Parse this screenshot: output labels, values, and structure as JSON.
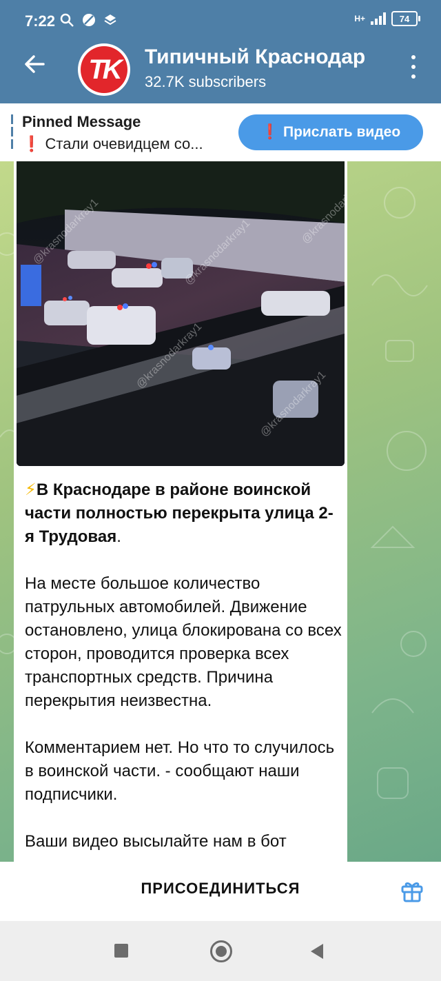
{
  "status_bar": {
    "time": "7:22",
    "network": "H+",
    "battery": "74"
  },
  "app_bar": {
    "channel_name": "Типичный Краснодар",
    "avatar_text": "TK",
    "subscribers": "32.7K subscribers"
  },
  "pinned": {
    "label": "Pinned Message",
    "preview_mark": "❗",
    "preview": "Стали очевидцем со...",
    "button_mark": "❗",
    "button_label": "Прислать видео"
  },
  "message": {
    "video_watermark": "@krasnodarkray1",
    "bolt": "⚡",
    "headline": "В Краснодаре в районе воинской части полностью перекрыта улица 2-я Трудовая",
    "headline_end": ".",
    "paragraph_2": "На месте  большое количество патрульных автомобилей. Движение остановлено, улица блокирована со всех сторон, проводится проверка всех транспортных средств. Причина перекрытия неизвестна.",
    "paragraph_3": "Комментарием нет. Но что то случилось в воинской части. - сообщают наши подписчики.",
    "paragraph_4": "Ваши видео высылайте нам в бот"
  },
  "join_bar": {
    "join_label": "ПРИСОЕДИНИТЬСЯ"
  },
  "colors": {
    "header": "#4e7fa7",
    "accent_button": "#4a9ae7",
    "brand_red": "#e2262b",
    "alert_red": "#e0282c"
  }
}
